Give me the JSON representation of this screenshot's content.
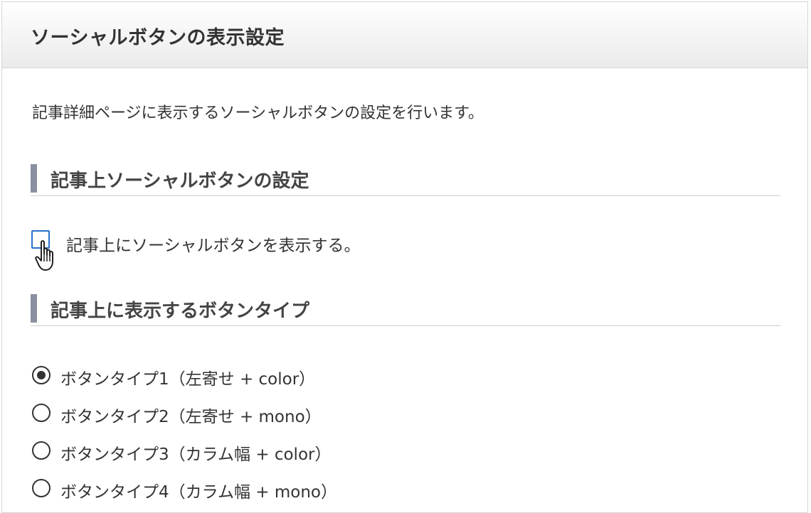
{
  "panel": {
    "title": "ソーシャルボタンの表示設定",
    "description": "記事詳細ページに表示するソーシャルボタンの設定を行います。"
  },
  "sections": [
    {
      "heading": "記事上ソーシャルボタンの設定",
      "checkbox": {
        "label": "記事上にソーシャルボタンを表示する。",
        "checked": false
      }
    },
    {
      "heading": "記事上に表示するボタンタイプ",
      "options": [
        {
          "label": "ボタンタイプ1（左寄せ + color）",
          "selected": true
        },
        {
          "label": "ボタンタイプ2（左寄せ + mono）",
          "selected": false
        },
        {
          "label": "ボタンタイプ3（カラム幅 + color）",
          "selected": false
        },
        {
          "label": "ボタンタイプ4（カラム幅 + mono）",
          "selected": false
        }
      ]
    }
  ],
  "icons": {
    "cursor": "hand-pointer-icon"
  },
  "colors": {
    "section_bar": "#8a90a0",
    "checkbox_border": "#2a72c7",
    "text": "#333333"
  }
}
